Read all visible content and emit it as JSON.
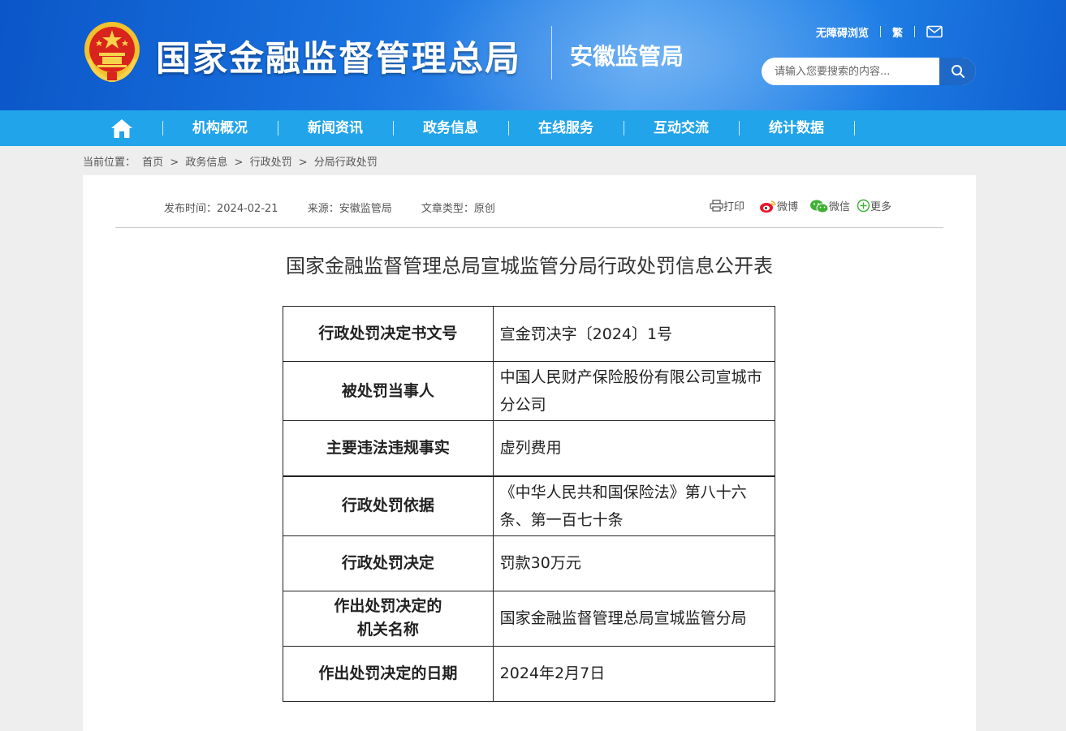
{
  "header": {
    "site_title": "国家金融监督管理总局",
    "branch_name": "安徽监管局",
    "accessibility_link": "无障碍浏览",
    "traditional_link": "繁",
    "mail_icon": "mail-icon",
    "search": {
      "placeholder": "请输入您要搜索的内容..."
    },
    "colors": {
      "header_blue": "#1a73e0",
      "nav_blue": "#22a4ea"
    }
  },
  "nav": {
    "home_icon": "home-icon",
    "items": [
      {
        "label": "机构概况"
      },
      {
        "label": "新闻资讯"
      },
      {
        "label": "政务信息"
      },
      {
        "label": "在线服务"
      },
      {
        "label": "互动交流"
      },
      {
        "label": "统计数据"
      }
    ]
  },
  "breadcrumb": {
    "prefix": "当前位置：",
    "items": [
      "首页",
      "政务信息",
      "行政处罚",
      "分局行政处罚"
    ],
    "separator": ">"
  },
  "article": {
    "publish_time": "发布时间：2024-02-21",
    "source": "来源：安徽监管局",
    "type": "文章类型：原创",
    "share": {
      "print": "打印",
      "weibo": "微博",
      "wechat": "微信",
      "more": "更多"
    },
    "title": "国家金融监督管理总局宣城监管分局行政处罚信息公开表",
    "table": [
      {
        "key": "行政处罚决定书文号",
        "value": "宣金罚决字〔2024〕1号"
      },
      {
        "key": "被处罚当事人",
        "value": "中国人民财产保险股份有限公司宣城市分公司"
      },
      {
        "key": "主要违法违规事实",
        "value": "虚列费用"
      },
      {
        "key": "行政处罚依据",
        "value": "《中华人民共和国保险法》第八十六条、第一百七十条"
      },
      {
        "key": "行政处罚决定",
        "value": "罚款30万元"
      },
      {
        "key": "作出处罚决定的机关名称",
        "value": "国家金融监督管理总局宣城监管分局"
      },
      {
        "key": "作出处罚决定的日期",
        "value": "2024年2月7日"
      }
    ]
  }
}
